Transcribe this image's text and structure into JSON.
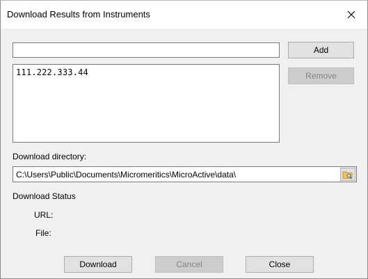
{
  "window": {
    "title": "Download Results from Instruments",
    "close_icon": "close-icon"
  },
  "instruments": {
    "input_value": "",
    "add_label": "Add",
    "remove_label": "Remove",
    "items": [
      "111.222.333.44"
    ]
  },
  "directory": {
    "label": "Download directory:",
    "path": "C:\\Users\\Public\\Documents\\Micromeritics\\MicroActive\\data\\",
    "browse_icon": "folder-search-icon"
  },
  "status": {
    "heading": "Download Status",
    "url_label": "URL:",
    "file_label": "File:"
  },
  "buttons": {
    "download": "Download",
    "cancel": "Cancel",
    "close": "Close"
  },
  "colors": {
    "dialog_bg": "#f0f0f0",
    "titlebar_bg": "#ffffff",
    "button_bg": "#e1e1e1",
    "disabled_text": "#838383"
  }
}
